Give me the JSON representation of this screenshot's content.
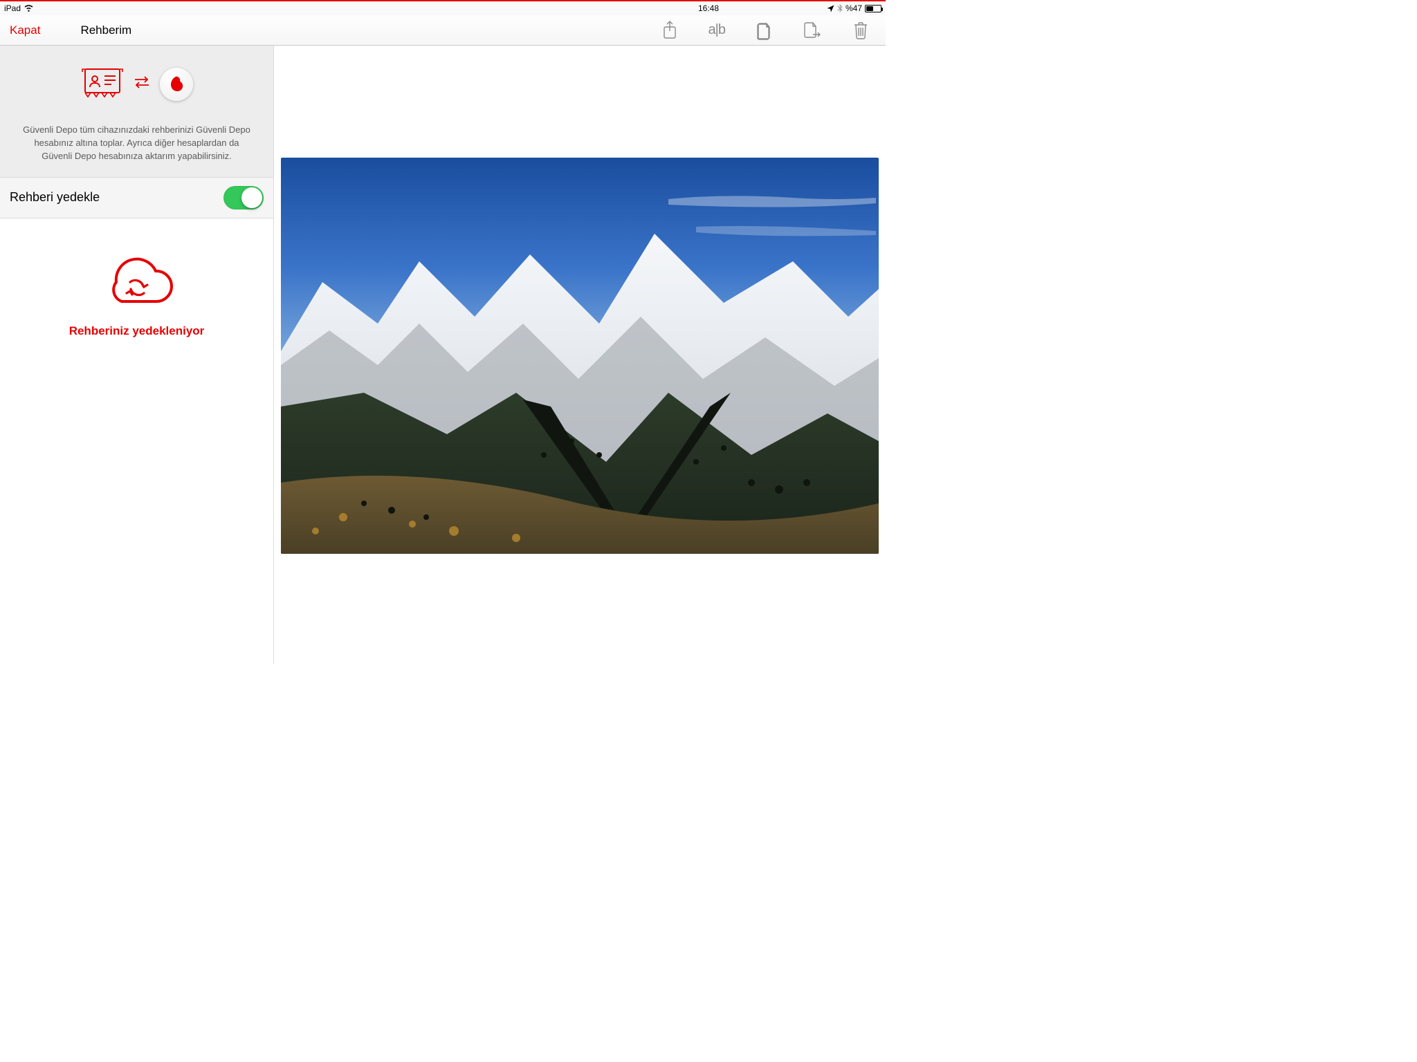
{
  "status_bar": {
    "device": "iPad",
    "time": "16:48",
    "battery_text": "%47",
    "battery_pct": 47
  },
  "nav": {
    "close": "Kapat",
    "title": "Rehberim",
    "tool_ab": "a|b"
  },
  "sidebar": {
    "info_text": "Güvenli Depo tüm cihazınızdaki rehberinizi Güvenli Depo hesabınız altına toplar. Ayrıca diğer hesaplardan da Güvenli Depo hesabınıza aktarım yapabilirsiniz.",
    "toggle_label": "Rehberi yedekle",
    "toggle_on": true,
    "status": "Rehberiniz yedekleniyor"
  }
}
